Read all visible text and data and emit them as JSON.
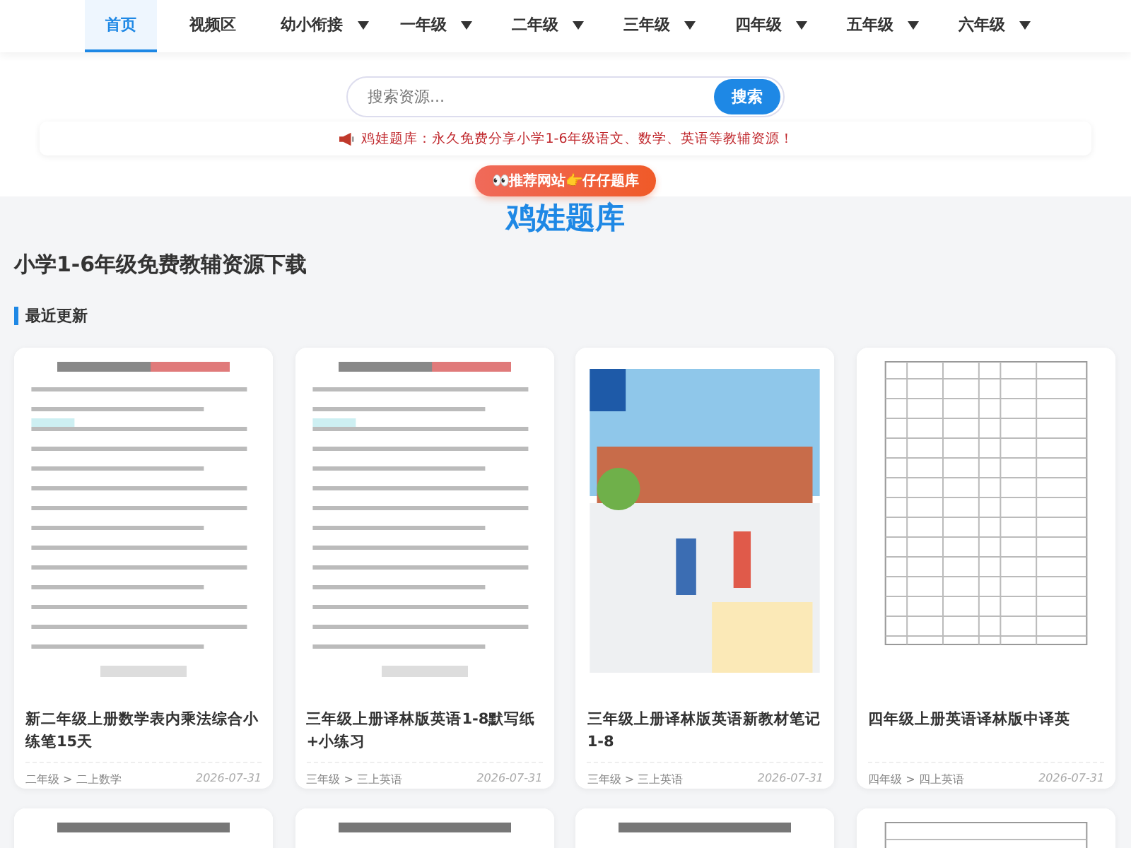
{
  "nav": {
    "items": [
      {
        "label": "首页",
        "selected": true,
        "dropdown": false
      },
      {
        "label": "视频区",
        "selected": false,
        "dropdown": false
      },
      {
        "label": "幼小衔接",
        "selected": false,
        "dropdown": true
      },
      {
        "label": "一年级",
        "selected": false,
        "dropdown": true
      },
      {
        "label": "二年级",
        "selected": false,
        "dropdown": true
      },
      {
        "label": "三年级",
        "selected": false,
        "dropdown": true
      },
      {
        "label": "四年级",
        "selected": false,
        "dropdown": true
      },
      {
        "label": "五年级",
        "selected": false,
        "dropdown": true
      },
      {
        "label": "六年级",
        "selected": false,
        "dropdown": true
      }
    ]
  },
  "search": {
    "placeholder": "搜索资源...",
    "button": "搜索"
  },
  "notice": "鸡娃题库：永久免费分享小学1-6年级语文、数学、英语等教辅资源！",
  "recommend": "👀推荐网站👉仔仔题库",
  "site_title": "鸡娃题库",
  "subtitle": "小学1-6年级免费教辅资源下载",
  "section": "最近更新",
  "cards": [
    {
      "kind": "worksheet",
      "title": "新二年级上册数学表内乘法综合小练笔15天",
      "category": "二年级 > 二上数学",
      "date": "2026-07-31"
    },
    {
      "kind": "worksheet",
      "title": "三年级上册译林版英语1-8默写纸+小练习",
      "category": "三年级 > 三上英语",
      "date": "2026-07-31"
    },
    {
      "kind": "textbook",
      "title": "三年级上册译林版英语新教材笔记1-8",
      "category": "三年级 > 三上英语",
      "date": "2026-07-31"
    },
    {
      "kind": "table",
      "title": "四年级上册英语译林版中译英",
      "category": "四年级 > 四上英语",
      "date": "2026-07-31"
    }
  ],
  "more_cards": [
    {
      "kind": "worksheet"
    },
    {
      "kind": "worksheet"
    },
    {
      "kind": "worksheet"
    },
    {
      "kind": "table"
    }
  ]
}
